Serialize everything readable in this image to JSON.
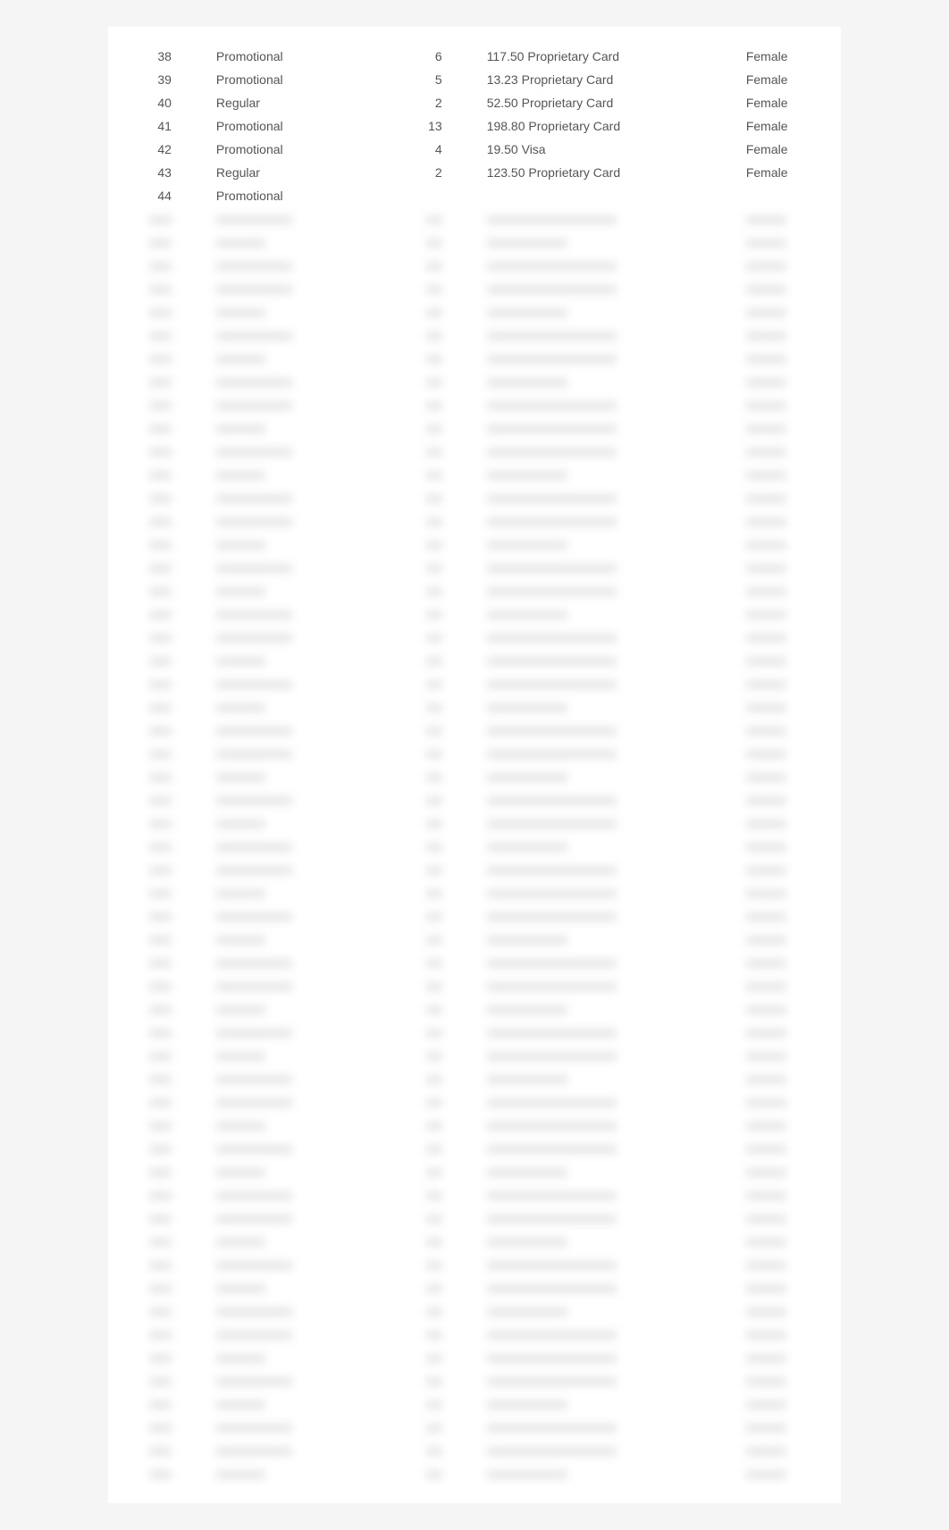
{
  "table": {
    "visible_rows": [
      {
        "id": "38",
        "type": "Promotional",
        "qty": "6",
        "payment": "117.50 Proprietary Card",
        "gender": "Female"
      },
      {
        "id": "39",
        "type": "Promotional",
        "qty": "5",
        "payment": "13.23 Proprietary Card",
        "gender": "Female"
      },
      {
        "id": "40",
        "type": "Regular",
        "qty": "2",
        "payment": "52.50 Proprietary Card",
        "gender": "Female"
      },
      {
        "id": "41",
        "type": "Promotional",
        "qty": "13",
        "payment": "198.80 Proprietary Card",
        "gender": "Female"
      },
      {
        "id": "42",
        "type": "Promotional",
        "qty": "4",
        "payment": "19.50 Visa",
        "gender": "Female"
      },
      {
        "id": "43",
        "type": "Regular",
        "qty": "2",
        "payment": "123.50 Proprietary Card",
        "gender": "Female"
      },
      {
        "id": "44",
        "type": "Promotional",
        "qty": "",
        "payment": "",
        "gender": ""
      }
    ],
    "blurred_row_count": 55
  }
}
